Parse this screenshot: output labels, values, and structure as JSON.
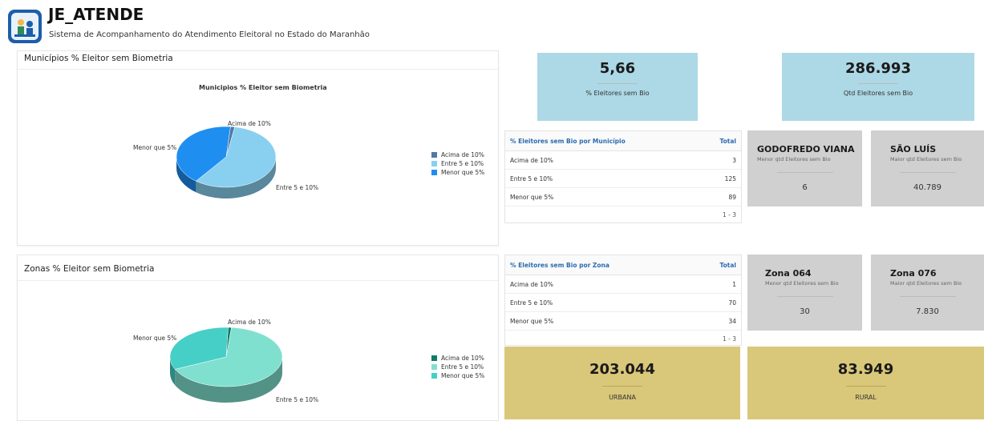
{
  "header": {
    "title": "JE_ATENDE",
    "subtitle": "Sistema de Acompanhamento do Atendimento Eleitoral no Estado do Maranhão"
  },
  "colors": {
    "kpi_blue": "#add8e6",
    "kpi_gold": "#d9c77a",
    "card_gray": "#d0d0d0",
    "link_blue": "#2b6cb0"
  },
  "municipios_panel": {
    "title": "Municípios % Eleitor sem Biometria",
    "chart_data": {
      "type": "pie",
      "title": "Municipios % Eleitor sem Biometria",
      "categories": [
        "Acima de 10%",
        "Entre 5 e 10%",
        "Menor que 5%"
      ],
      "values": [
        3,
        125,
        89
      ],
      "colors": [
        "#4e79a7",
        "#89cff0",
        "#1f8ef1"
      ],
      "legend": "right"
    },
    "legend": [
      "Acima de 10%",
      "Entre 5 e 10%",
      "Menor que 5%"
    ],
    "labels": {
      "acima": "Acima de 10%",
      "entre": "Entre 5 e 10%",
      "menor": "Menor que 5%"
    }
  },
  "zonas_panel": {
    "title": "Zonas % Eleitor sem Biometria",
    "chart_data": {
      "type": "pie",
      "categories": [
        "Acima de 10%",
        "Entre 5 e 10%",
        "Menor que 5%"
      ],
      "values": [
        1,
        70,
        34
      ],
      "colors": [
        "#0e7c6b",
        "#80e0d0",
        "#45cfc7"
      ],
      "legend": "right"
    },
    "legend": [
      "Acima de 10%",
      "Entre 5 e 10%",
      "Menor que 5%"
    ],
    "labels": {
      "acima": "Acima de 10%",
      "entre": "Entre 5 e 10%",
      "menor": "Menor que 5%"
    }
  },
  "kpis": {
    "pct_sem_bio": {
      "value": "5,66",
      "label": "% Eleitores sem Bio"
    },
    "qtd_sem_bio": {
      "value": "286.993",
      "label": "Qtd Eleitores sem Bio"
    },
    "urbana": {
      "value": "203.044",
      "label": "URBANA"
    },
    "rural": {
      "value": "83.949",
      "label": "RURAL"
    }
  },
  "table_municipio": {
    "header": "% Eleitores sem Bio por Município",
    "total_header": "Total",
    "rows": [
      {
        "label": "Acima de 10%",
        "total": "3"
      },
      {
        "label": "Entre 5 e 10%",
        "total": "125"
      },
      {
        "label": "Menor que 5%",
        "total": "89"
      }
    ],
    "pagination": "1 - 3"
  },
  "table_zona": {
    "header": "% Eleitores sem Bio por Zona",
    "total_header": "Total",
    "rows": [
      {
        "label": "Acima de 10%",
        "total": "1"
      },
      {
        "label": "Entre 5 e 10%",
        "total": "70"
      },
      {
        "label": "Menor que 5%",
        "total": "34"
      }
    ],
    "pagination": "1 - 3"
  },
  "cards_municipio": [
    {
      "name": "GODOFREDO VIANA",
      "sub": "Menor qtd Eleitores sem Bio",
      "value": "6"
    },
    {
      "name": "SÃO LUÍS",
      "sub": "Maior qtd Eleitores sem Bio",
      "value": "40.789"
    }
  ],
  "cards_zona": [
    {
      "name": "Zona 064",
      "sub": "Menor qtd Eleitores sem Bio",
      "value": "30"
    },
    {
      "name": "Zona 076",
      "sub": "Maior qtd Eleitores sem Bio",
      "value": "7.830"
    }
  ]
}
